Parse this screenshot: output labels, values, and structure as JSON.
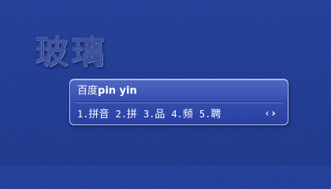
{
  "banner": {
    "text": "玻璃"
  },
  "ime": {
    "composition_prefix": "百度",
    "composition_pinyin": "pin yin",
    "candidates": [
      {
        "index": "1.",
        "text": "拼音"
      },
      {
        "index": "2.",
        "text": "拼"
      },
      {
        "index": "3.",
        "text": "品"
      },
      {
        "index": "4.",
        "text": "频"
      },
      {
        "index": "5.",
        "text": "聘"
      }
    ],
    "prev_page": "‹",
    "next_page": "›"
  },
  "colors": {
    "background": "#223a90",
    "panel_border": "#b9c6ff",
    "text": "#ffffff"
  }
}
